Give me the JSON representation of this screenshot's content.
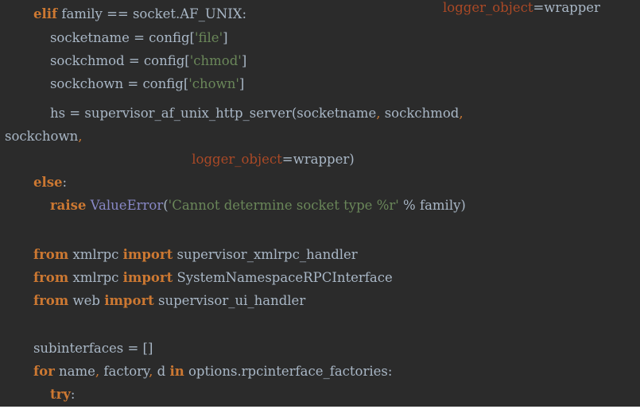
{
  "editor": {
    "background": "#2b2b2b",
    "colors": {
      "keyword": "#cc7832",
      "string": "#6a8759",
      "parameter": "#aa4926",
      "builtin": "#8888c6",
      "text": "#a9b7c6"
    },
    "top_fragment": {
      "segments": [
        {
          "text": "logger_object",
          "cls": "param"
        },
        {
          "text": "=wrapper",
          "cls": "plain"
        }
      ]
    },
    "lines": [
      {
        "segments": [
          {
            "text": "        ",
            "cls": "plain"
          },
          {
            "text": "elif",
            "cls": "kw"
          },
          {
            "text": " family == socket.AF_UNIX:",
            "cls": "plain"
          }
        ]
      },
      {
        "segments": [
          {
            "text": "            socketname = config[",
            "cls": "plain"
          },
          {
            "text": "'file'",
            "cls": "str"
          },
          {
            "text": "]",
            "cls": "plain"
          }
        ]
      },
      {
        "segments": [
          {
            "text": "            sockchmod = config[",
            "cls": "plain"
          },
          {
            "text": "'chmod'",
            "cls": "str"
          },
          {
            "text": "]",
            "cls": "plain"
          }
        ]
      },
      {
        "segments": [
          {
            "text": "            sockchown = config[",
            "cls": "plain"
          },
          {
            "text": "'chown'",
            "cls": "str"
          },
          {
            "text": "]",
            "cls": "plain"
          }
        ]
      },
      {
        "segments": [
          {
            "text": "            hs = supervisor_af_unix_http_server(socketname",
            "cls": "plain"
          },
          {
            "text": ",",
            "cls": "punct"
          },
          {
            "text": " sockchmod",
            "cls": "plain"
          },
          {
            "text": ",",
            "cls": "punct"
          }
        ]
      },
      {
        "segments": [
          {
            "text": "sockchown",
            "cls": "plain"
          },
          {
            "text": ",",
            "cls": "punct"
          }
        ]
      },
      {
        "segments": [
          {
            "text": "                                              ",
            "cls": "plain"
          },
          {
            "text": "logger_object",
            "cls": "param"
          },
          {
            "text": "=wrapper)",
            "cls": "plain"
          }
        ]
      },
      {
        "segments": [
          {
            "text": "        ",
            "cls": "plain"
          },
          {
            "text": "else",
            "cls": "kw"
          },
          {
            "text": ":",
            "cls": "plain"
          }
        ]
      },
      {
        "segments": [
          {
            "text": "            ",
            "cls": "plain"
          },
          {
            "text": "raise",
            "cls": "kw"
          },
          {
            "text": " ",
            "cls": "plain"
          },
          {
            "text": "ValueError",
            "cls": "builtin"
          },
          {
            "text": "(",
            "cls": "plain"
          },
          {
            "text": "'Cannot determine socket type %r'",
            "cls": "str"
          },
          {
            "text": " % family)",
            "cls": "plain"
          }
        ]
      },
      {
        "segments": [
          {
            "text": "",
            "cls": "plain"
          }
        ]
      },
      {
        "segments": [
          {
            "text": "        ",
            "cls": "plain"
          },
          {
            "text": "from",
            "cls": "kw"
          },
          {
            "text": " xmlrpc ",
            "cls": "plain"
          },
          {
            "text": "import",
            "cls": "kw"
          },
          {
            "text": " supervisor_xmlrpc_handler",
            "cls": "plain"
          }
        ]
      },
      {
        "segments": [
          {
            "text": "        ",
            "cls": "plain"
          },
          {
            "text": "from",
            "cls": "kw"
          },
          {
            "text": " xmlrpc ",
            "cls": "plain"
          },
          {
            "text": "import",
            "cls": "kw"
          },
          {
            "text": " SystemNamespaceRPCInterface",
            "cls": "plain"
          }
        ]
      },
      {
        "segments": [
          {
            "text": "        ",
            "cls": "plain"
          },
          {
            "text": "from",
            "cls": "kw"
          },
          {
            "text": " web ",
            "cls": "plain"
          },
          {
            "text": "import",
            "cls": "kw"
          },
          {
            "text": " supervisor_ui_handler",
            "cls": "plain"
          }
        ]
      },
      {
        "segments": [
          {
            "text": "",
            "cls": "plain"
          }
        ]
      },
      {
        "segments": [
          {
            "text": "        subinterfaces = []",
            "cls": "plain"
          }
        ]
      },
      {
        "segments": [
          {
            "text": "        ",
            "cls": "plain"
          },
          {
            "text": "for",
            "cls": "kw"
          },
          {
            "text": " name",
            "cls": "plain"
          },
          {
            "text": ",",
            "cls": "punct"
          },
          {
            "text": " factory",
            "cls": "plain"
          },
          {
            "text": ",",
            "cls": "punct"
          },
          {
            "text": " d ",
            "cls": "plain"
          },
          {
            "text": "in",
            "cls": "kw"
          },
          {
            "text": " options.rpcinterface_factories:",
            "cls": "plain"
          }
        ]
      },
      {
        "segments": [
          {
            "text": "            ",
            "cls": "plain"
          },
          {
            "text": "try",
            "cls": "kw"
          },
          {
            "text": ":",
            "cls": "plain"
          }
        ]
      }
    ]
  }
}
